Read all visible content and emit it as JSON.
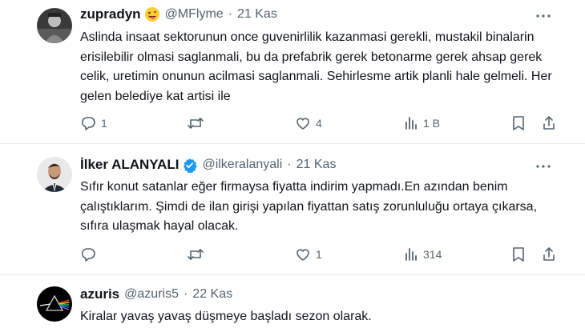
{
  "tweets": [
    {
      "name": "zupradyn",
      "handle": "@MFlyme",
      "date": "21 Kas",
      "text": "Aslinda insaat sektorunun once guvenirlilik kazanmasi gerekli, mustakil binalarin erisilebilir olmasi saglanmali, bu da prefabrik gerek betonarme gerek ahsap gerek celik, uretimin onunun acilmasi saglanmali. Sehirlesme artik planli hale gelmeli. Her gelen belediye kat artisi ile",
      "replies": "1",
      "retweets": "",
      "likes": "4",
      "views": "1 B"
    },
    {
      "name": "İlker ALANYALI",
      "handle": "@ilkeralanyali",
      "date": "21 Kas",
      "text": "Sıfır konut satanlar eğer firmaysa fiyatta indirim yapmadı.En azından benim çalıştıklarım. Şimdi de ilan girişi yapılan fiyattan satış zorunluluğu ortaya çıkarsa, sıfıra ulaşmak hayal olacak.",
      "replies": "",
      "retweets": "",
      "likes": "1",
      "views": "314"
    },
    {
      "name": "azuris",
      "handle": "@azuris5",
      "date": "22 Kas",
      "text": "Kiralar yavaş yavaş düşmeye başladı sezon olarak."
    }
  ],
  "colors": {
    "text": "#0f1419",
    "muted": "#536471",
    "verified": "#1d9bf0",
    "divider": "#e6ecf0"
  },
  "icons": [
    "reply-icon",
    "retweet-icon",
    "like-icon",
    "views-icon",
    "bookmark-icon",
    "share-icon",
    "more-icon",
    "verified-badge-icon",
    "emoji-icon"
  ]
}
